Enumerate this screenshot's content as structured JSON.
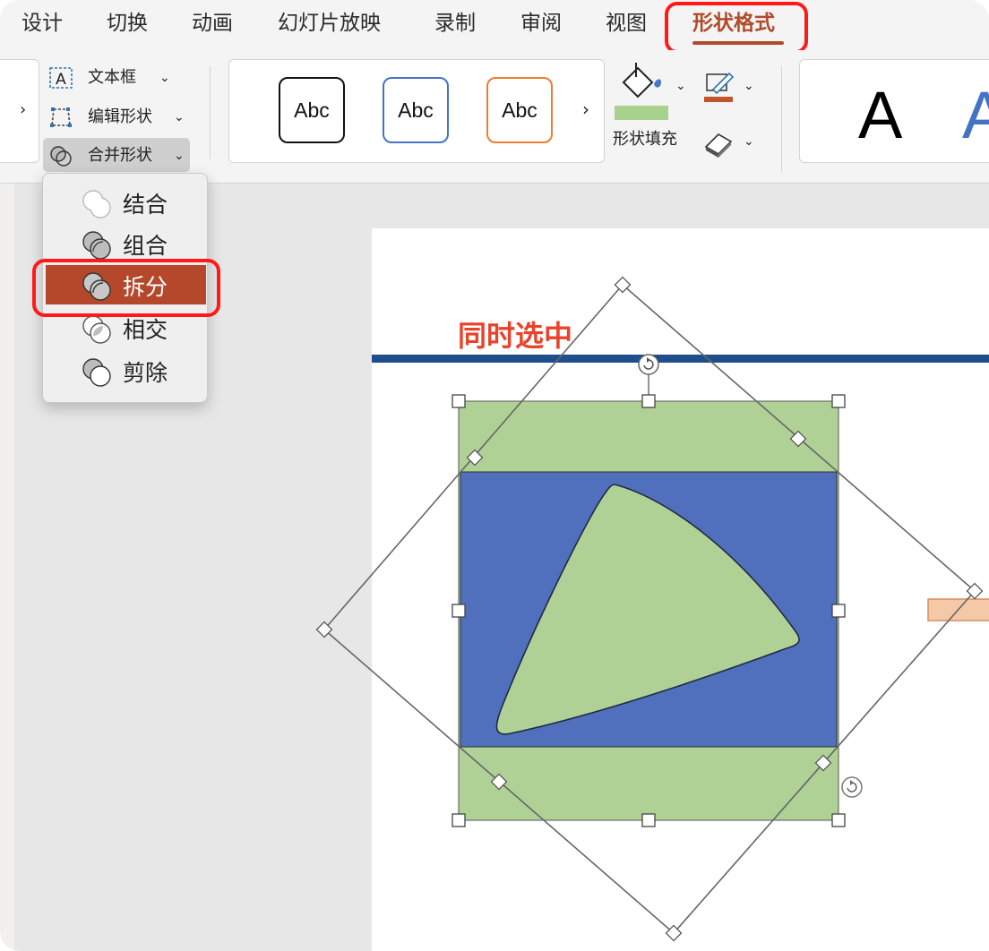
{
  "tabs": [
    {
      "label": "设计",
      "active": false
    },
    {
      "label": "切换",
      "active": false
    },
    {
      "label": "动画",
      "active": false
    },
    {
      "label": "幻灯片放映",
      "active": false
    },
    {
      "label": "录制",
      "active": false
    },
    {
      "label": "审阅",
      "active": false
    },
    {
      "label": "视图",
      "active": false
    },
    {
      "label": "形状格式",
      "active": true
    }
  ],
  "ribbon": {
    "text_box": "文本框",
    "edit_shape": "编辑形状",
    "merge_shapes": "合并形状",
    "style_samples": [
      "Abc",
      "Abc",
      "Abc"
    ],
    "shape_fill": "形状填充",
    "wordart_sample": "A",
    "wordart_sample_2": "A"
  },
  "merge_menu": {
    "items": [
      {
        "label": "结合",
        "icon": "union-icon"
      },
      {
        "label": "组合",
        "icon": "combine-icon"
      },
      {
        "label": "拆分",
        "icon": "fragment-icon",
        "selected": true
      },
      {
        "label": "相交",
        "icon": "intersect-icon"
      },
      {
        "label": "剪除",
        "icon": "subtract-icon"
      }
    ]
  },
  "slide": {
    "annotation": "同时选中"
  },
  "colors": {
    "accent": "#b5472a",
    "highlight_red": "#ff1a1a",
    "shape_green": "#b0d196",
    "shape_blue": "#5070bd",
    "title_bar_blue": "#1f4e8c",
    "fill_swatch": "#a9d18e",
    "outline_swatch": "#c0552b",
    "annotation_red": "#e8432c"
  }
}
